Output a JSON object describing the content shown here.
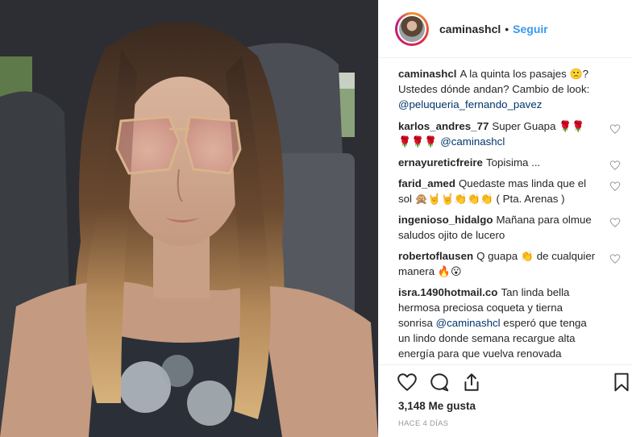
{
  "post": {
    "username": "caminashcl",
    "separator": "•",
    "follow_label": "Seguir"
  },
  "caption": {
    "username": "caminashcl",
    "line1": "A la quinta los pasajes",
    "emoji1": "🙁",
    "line1_end": "? Ustedes dónde andan? Cambio de look:",
    "mention": "@peluqueria_fernando_pavez"
  },
  "comments": [
    {
      "username": "karlos_andres_77",
      "text": "Super Guapa",
      "emoji": "🌹🌹🌹🌹🌹",
      "mention": "@caminashcl"
    },
    {
      "username": "ernayureticfreire",
      "text": "Topisima ..."
    },
    {
      "username": "farid_amed",
      "text": "Quedaste mas linda que el sol",
      "emoji": "🙊🤘🤘👏👏👏",
      "text2": "( Pta. Arenas )"
    },
    {
      "username": "ingenioso_hidalgo",
      "text": "Mañana para olmue saludos ojito de lucero"
    },
    {
      "username": "robertoflausen",
      "text": "Q guapa",
      "emoji": "👏",
      "text2": "de cualquier manera",
      "emoji2": "🔥😮"
    },
    {
      "username": "isra.1490hotmail.co",
      "text": "Tan linda bella hermosa preciosa coqueta y tierna sonrisa",
      "mention": "@caminashcl",
      "text2": "esperó que tenga un lindo donde semana recargue alta energía para que vuelva renovada"
    }
  ],
  "likes_label": "3,148 Me gusta",
  "time_label": "HACE 4 DÍAS",
  "icons": {
    "like": "heart-icon",
    "comment": "comment-icon",
    "share": "share-icon",
    "save": "bookmark-icon"
  },
  "colors": {
    "follow": "#3897f0",
    "mention": "#003569",
    "meta": "#999999"
  }
}
